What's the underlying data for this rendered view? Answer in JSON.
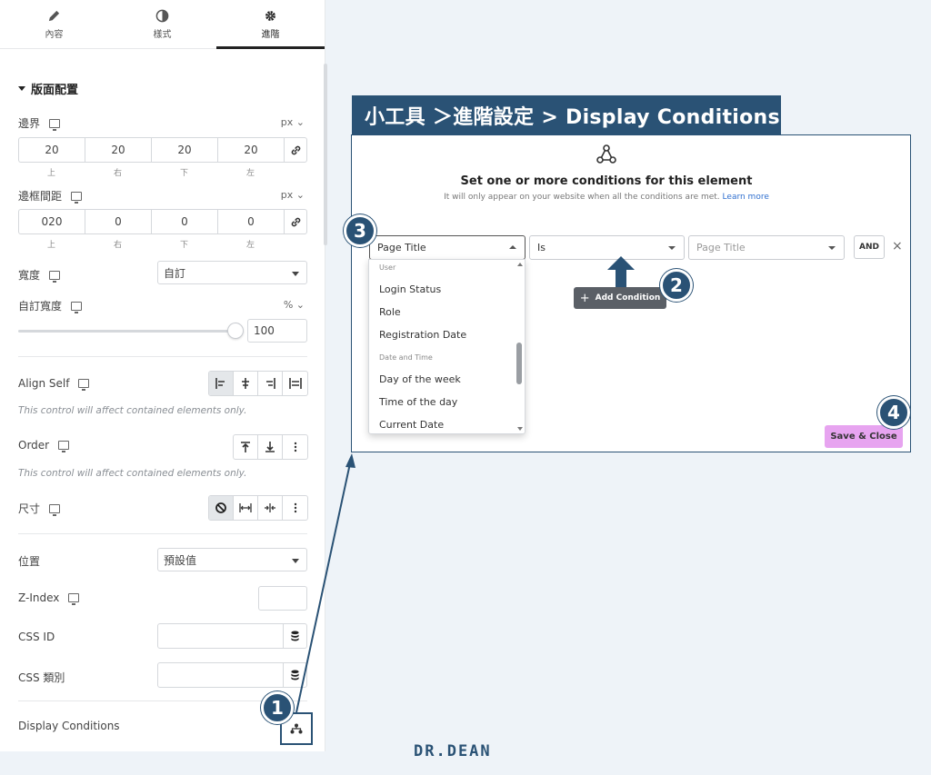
{
  "tabs": [
    {
      "label": "內容",
      "icon": "pencil-icon"
    },
    {
      "label": "樣式",
      "icon": "contrast-icon"
    },
    {
      "label": "進階",
      "icon": "gear-icon",
      "active": true
    }
  ],
  "layout_section": {
    "title": "版面配置",
    "margin": {
      "label": "邊界",
      "unit": "px",
      "values": [
        "20",
        "20",
        "20",
        "20"
      ],
      "sides": [
        "上",
        "右",
        "下",
        "左"
      ]
    },
    "padding": {
      "label": "邊框間距",
      "unit": "px",
      "values": [
        "020",
        "0",
        "0",
        "0"
      ],
      "sides": [
        "上",
        "右",
        "下",
        "左"
      ]
    },
    "width": {
      "label": "寬度",
      "value": "自訂"
    },
    "custom_width": {
      "label": "自訂寬度",
      "unit": "%",
      "value": "100",
      "fraction": 1.0
    }
  },
  "align_self": {
    "label": "Align Self",
    "note": "This control will affect contained elements only."
  },
  "order": {
    "label": "Order",
    "note": "This control will affect contained elements only."
  },
  "size": {
    "label": "尺寸"
  },
  "position": {
    "label": "位置",
    "value": "預設值"
  },
  "z_index": {
    "label": "Z-Index"
  },
  "css_id": {
    "label": "CSS ID"
  },
  "css_class": {
    "label": "CSS 類別"
  },
  "display_conditions": {
    "label": "Display Conditions"
  },
  "banner": {
    "text": "小工具 ＞進階設定 > Display Conditions"
  },
  "modal": {
    "title": "Set one or more conditions for this element",
    "subtitle": "It will only appear on your website when all the conditions are met.",
    "learn_more": "Learn more",
    "condition": {
      "field": "Page Title",
      "operator": "Is",
      "value_placeholder": "Page Title",
      "and_label": "AND",
      "remove": "×"
    },
    "dropdown": [
      {
        "type": "group",
        "label": "User"
      },
      {
        "type": "item",
        "label": "Login Status"
      },
      {
        "type": "item",
        "label": "Role"
      },
      {
        "type": "item",
        "label": "Registration Date"
      },
      {
        "type": "group",
        "label": "Date and Time"
      },
      {
        "type": "item",
        "label": "Day of the week"
      },
      {
        "type": "item",
        "label": "Time of the day"
      },
      {
        "type": "item",
        "label": "Current Date"
      }
    ],
    "add_condition": "Add Condition",
    "save_close": "Save & Close"
  },
  "badges": [
    "1",
    "2",
    "3",
    "4"
  ],
  "colors": {
    "accent": "#2a5275",
    "save": "#e7a4f0",
    "add_condition": "#5a5f66"
  },
  "logo": "DR.DEAN"
}
